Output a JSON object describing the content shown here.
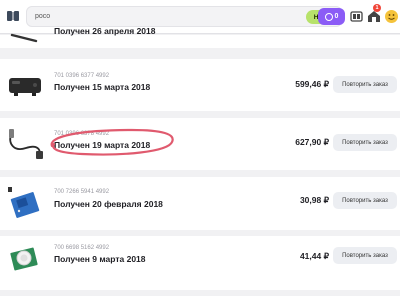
{
  "header": {
    "search_value": "poco",
    "search_button": "Найти",
    "points_value": "0",
    "orders_badge": "1",
    "icons": [
      "catalog-icon",
      "compare-icon",
      "orders-icon",
      "profile-icon"
    ],
    "accent_color": "#8b5cf6",
    "search_button_color": "#b7e26a"
  },
  "orders": [
    {
      "status": "Получен 26 апреля 2018",
      "product_icon": "cable-product-icon"
    },
    {
      "number": "701 0396 6377 4992",
      "status": "Получен 15 марта 2018",
      "price": "599,46 ₽",
      "repeat_label": "Повторить заказ",
      "product_icon": "av-converter-product-icon"
    },
    {
      "number": "701 0396 6378 4992",
      "status": "Получен 19 марта 2018",
      "price": "627,90 ₽",
      "repeat_label": "Повторить заказ",
      "product_icon": "sensor-cable-product-icon"
    },
    {
      "number": "700 7266 5941 4992",
      "status": "Получен 20 февраля 2018",
      "price": "30,98 ₽",
      "repeat_label": "Повторить заказ",
      "product_icon": "relay-module-product-icon"
    },
    {
      "number": "700 6698 5162 4992",
      "status": "Получен 9 марта 2018",
      "price": "41,44 ₽",
      "repeat_label": "Повторить заказ",
      "product_icon": "pir-sensor-product-icon"
    }
  ],
  "annotation_color": "#e05a6e"
}
